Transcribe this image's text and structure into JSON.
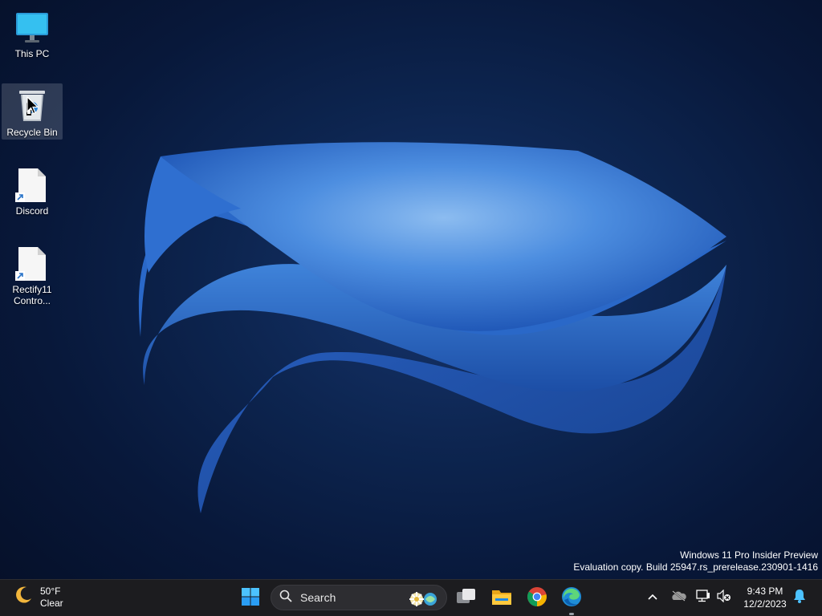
{
  "desktop": {
    "icons": [
      {
        "label": "This PC",
        "icon": "monitor-icon"
      },
      {
        "label": "Recycle Bin",
        "icon": "recycle-bin-icon",
        "selected": true
      },
      {
        "label": "Discord",
        "icon": "shortcut-file-icon"
      },
      {
        "label": "Rectify11 Contro...",
        "icon": "shortcut-file-icon"
      }
    ]
  },
  "watermark": {
    "line1": "Windows 11 Pro Insider Preview",
    "line2": "Evaluation copy. Build 25947.rs_prerelease.230901-1416"
  },
  "taskbar": {
    "weather": {
      "temperature": "50°F",
      "condition": "Clear",
      "icon": "moon-icon"
    },
    "search": {
      "label": "Search"
    },
    "pinned": [
      "start-icon",
      "task-view-icon",
      "file-explorer-icon",
      "chrome-icon",
      "edge-icon"
    ],
    "tray": {
      "icons": [
        "chevron-up-icon",
        "onedrive-icon",
        "network-icon",
        "volume-muted-icon"
      ],
      "time": "9:43 PM",
      "date": "12/2/2023",
      "notification_icon": "bell-icon"
    }
  },
  "colors": {
    "accent": "#3a7de0",
    "taskbar": "#1c1c1f",
    "background": "#0b1e45"
  }
}
